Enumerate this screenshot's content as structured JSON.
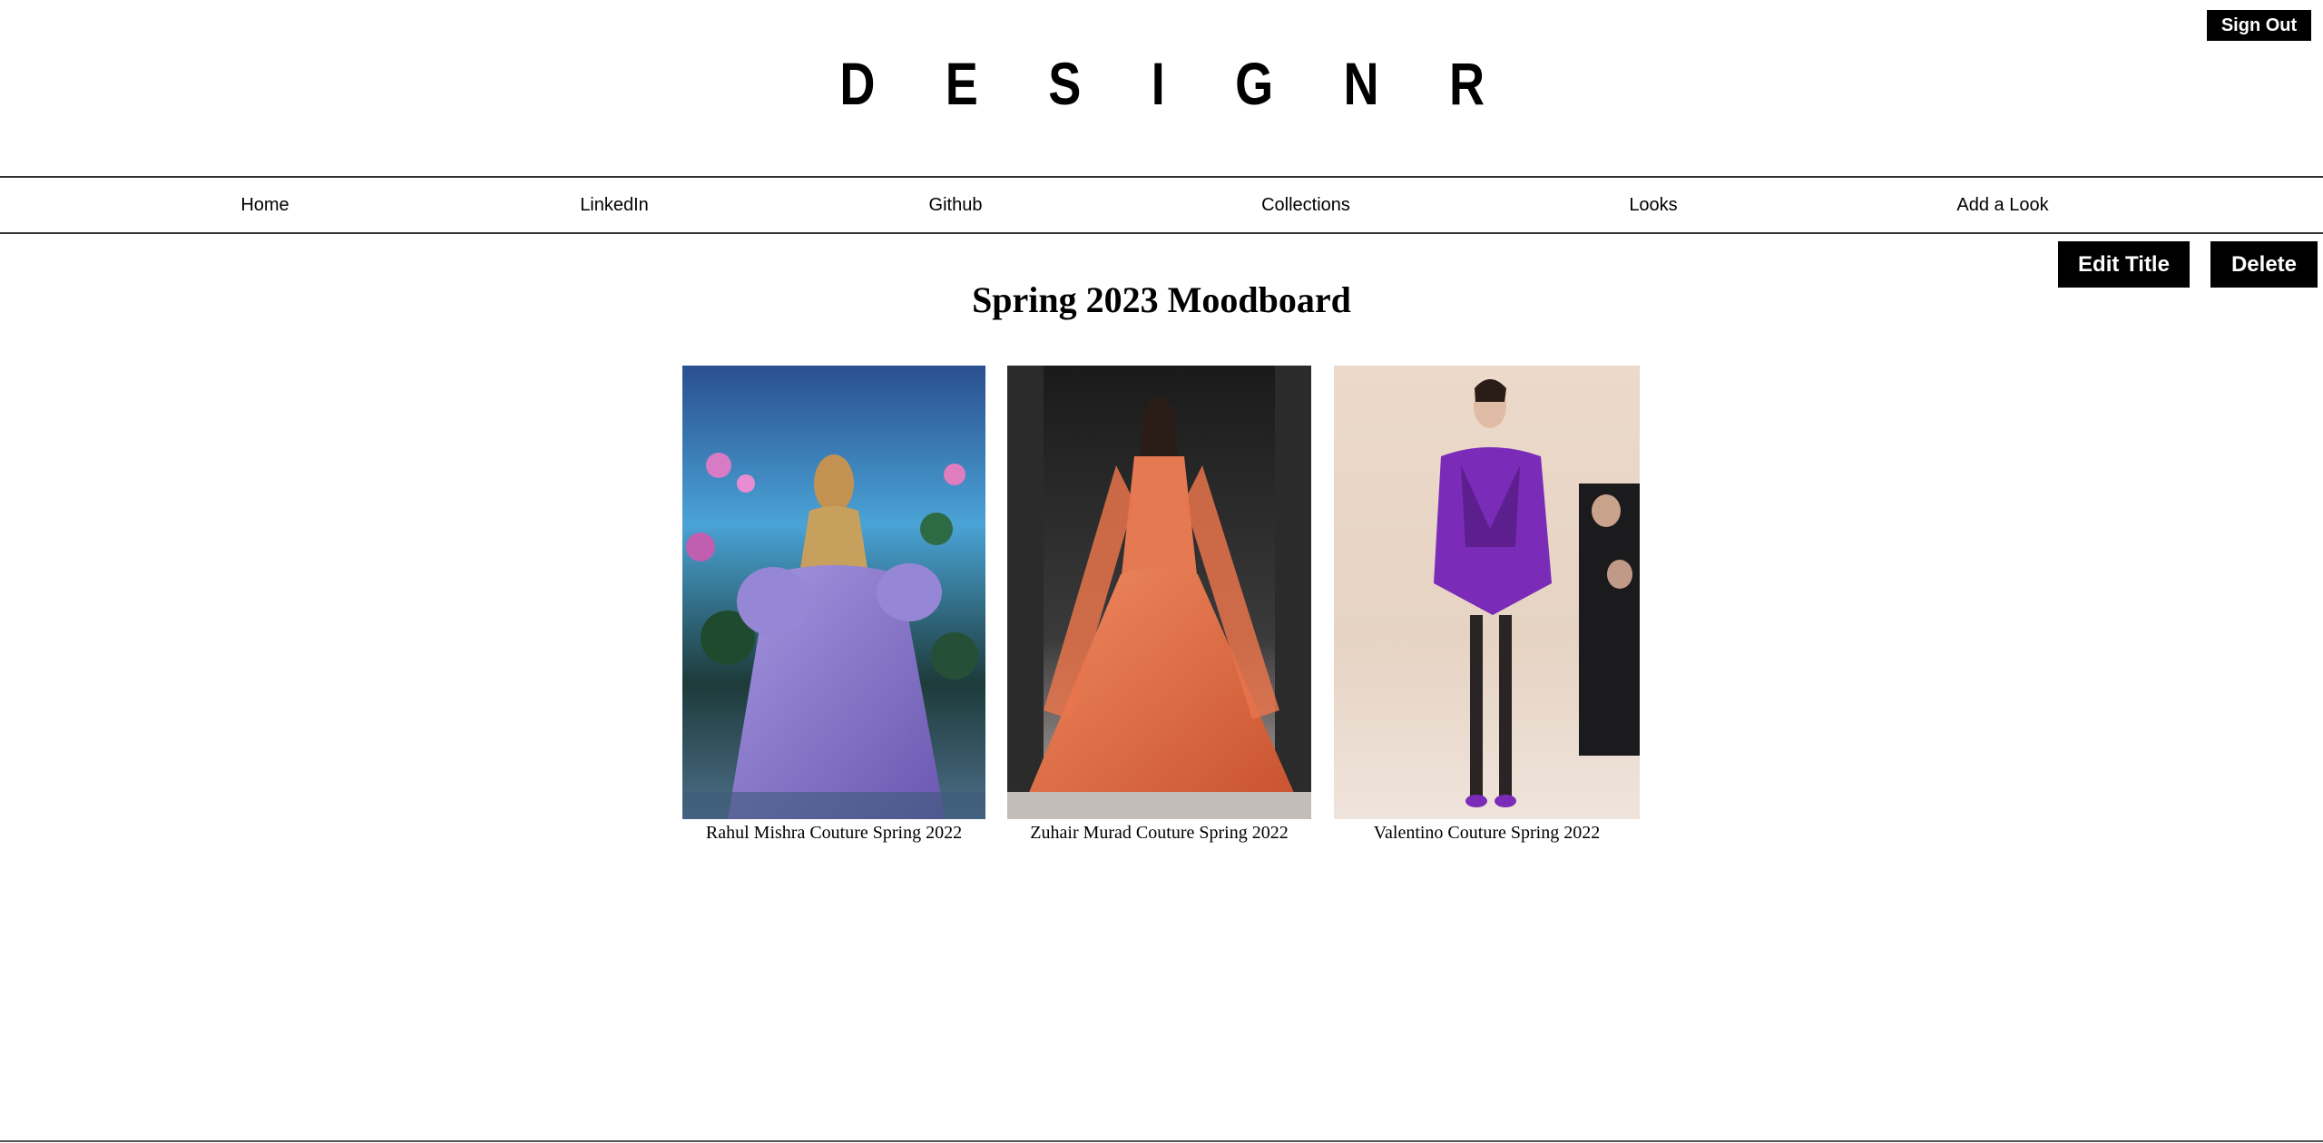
{
  "header": {
    "logo": "D E S I G N R",
    "sign_out_label": "Sign Out"
  },
  "nav": {
    "items": [
      {
        "label": "Home"
      },
      {
        "label": "LinkedIn"
      },
      {
        "label": "Github"
      },
      {
        "label": "Collections"
      },
      {
        "label": "Looks"
      },
      {
        "label": "Add a Look"
      }
    ]
  },
  "board": {
    "title": "Spring 2023 Moodboard",
    "edit_title_label": "Edit Title",
    "delete_label": "Delete",
    "looks": [
      {
        "caption": "Rahul Mishra Couture Spring 2022",
        "dress_color": "#8a77c9"
      },
      {
        "caption": "Zuhair Murad Couture Spring 2022",
        "dress_color": "#e26a45"
      },
      {
        "caption": "Valentino Couture Spring 2022",
        "dress_color": "#7a2bb8"
      }
    ]
  }
}
